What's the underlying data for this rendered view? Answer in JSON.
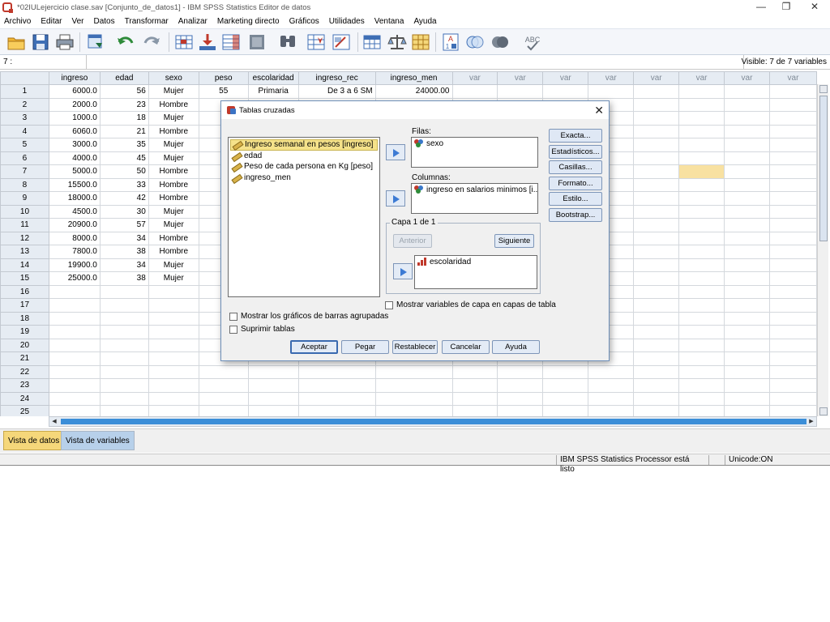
{
  "window": {
    "title": "*02IULejercicio clase.sav [Conjunto_de_datos1] - IBM SPSS Statistics Editor de datos"
  },
  "menu": [
    "Archivo",
    "Editar",
    "Ver",
    "Datos",
    "Transformar",
    "Analizar",
    "Marketing directo",
    "Gráficos",
    "Utilidades",
    "Ventana",
    "Ayuda"
  ],
  "toolbar_icons": [
    "open-icon",
    "save-icon",
    "print-icon",
    "dialog-recall-icon",
    "undo-icon",
    "redo-icon",
    "goto-case-icon",
    "goto-variable-icon",
    "variables-icon",
    "run-descriptives-icon",
    "find-icon",
    "insert-cases-icon",
    "insert-variable-icon",
    "split-file-icon",
    "weight-cases-icon",
    "select-cases-icon",
    "value-labels-icon",
    "use-sets-icon",
    "show-all-icon",
    "spell-check-icon"
  ],
  "cellbar": {
    "ref": "7 :",
    "value": "",
    "visible": "Visible: 7 de 7 variables"
  },
  "grid": {
    "columns": [
      "ingreso",
      "edad",
      "sexo",
      "peso",
      "escolaridad",
      "ingreso_rec",
      "ingreso_men",
      "var",
      "var",
      "var",
      "var",
      "var",
      "var",
      "var",
      "var"
    ],
    "rows": [
      [
        "1",
        "6000.0",
        "56",
        "Mujer",
        "55",
        "Primaria",
        "De 3 a 6 SM",
        "24000.00"
      ],
      [
        "2",
        "2000.0",
        "23",
        "Hombre",
        "",
        "",
        "",
        ""
      ],
      [
        "3",
        "1000.0",
        "18",
        "Mujer",
        "",
        "",
        "",
        ""
      ],
      [
        "4",
        "6060.0",
        "21",
        "Hombre",
        "",
        "",
        "",
        ""
      ],
      [
        "5",
        "3000.0",
        "35",
        "Mujer",
        "",
        "",
        "",
        ""
      ],
      [
        "6",
        "4000.0",
        "45",
        "Mujer",
        "",
        "",
        "",
        ""
      ],
      [
        "7",
        "5000.0",
        "50",
        "Hombre",
        "",
        "",
        "",
        ""
      ],
      [
        "8",
        "15500.0",
        "33",
        "Hombre",
        "",
        "",
        "",
        ""
      ],
      [
        "9",
        "18000.0",
        "42",
        "Hombre",
        "",
        "",
        "",
        ""
      ],
      [
        "10",
        "4500.0",
        "30",
        "Mujer",
        "",
        "",
        "",
        ""
      ],
      [
        "11",
        "20900.0",
        "57",
        "Mujer",
        "",
        "",
        "",
        ""
      ],
      [
        "12",
        "8000.0",
        "34",
        "Hombre",
        "",
        "",
        "",
        ""
      ],
      [
        "13",
        "7800.0",
        "38",
        "Hombre",
        "",
        "",
        "",
        ""
      ],
      [
        "14",
        "19900.0",
        "34",
        "Mujer",
        "",
        "",
        "",
        ""
      ],
      [
        "15",
        "25000.0",
        "38",
        "Mujer",
        "",
        "",
        "",
        ""
      ],
      [
        "16",
        "",
        "",
        "",
        "",
        "",
        "",
        ""
      ],
      [
        "17",
        "",
        "",
        "",
        "",
        "",
        "",
        ""
      ],
      [
        "18",
        "",
        "",
        "",
        "",
        "",
        "",
        ""
      ],
      [
        "19",
        "",
        "",
        "",
        "",
        "",
        "",
        ""
      ],
      [
        "20",
        "",
        "",
        "",
        "",
        "",
        "",
        ""
      ],
      [
        "21",
        "",
        "",
        "",
        "",
        "",
        "",
        ""
      ],
      [
        "22",
        "",
        "",
        "",
        "",
        "",
        "",
        ""
      ],
      [
        "23",
        "",
        "",
        "",
        "",
        "",
        "",
        ""
      ],
      [
        "24",
        "",
        "",
        "",
        "",
        "",
        "",
        ""
      ],
      [
        "25",
        "",
        "",
        "",
        "",
        "",
        "",
        ""
      ]
    ],
    "highlight_color": "#f8e1a1"
  },
  "tabs": {
    "data_view": "Vista de datos",
    "variable_view": "Vista de variables"
  },
  "status": {
    "processor": "IBM SPSS Statistics Processor está listo",
    "unicode": "Unicode:ON"
  },
  "dialog": {
    "title": "Tablas cruzadas",
    "source_vars": [
      {
        "label": "Ingreso semanal en pesos [ingreso]",
        "selected": true
      },
      {
        "label": "edad",
        "selected": false
      },
      {
        "label": "Peso de cada persona en Kg [peso]",
        "selected": false
      },
      {
        "label": "ingreso_men",
        "selected": false
      }
    ],
    "rows_label": "Filas:",
    "rows_var": "sexo",
    "columns_label": "Columnas:",
    "columns_var": "ingreso en salarios minimos [i...",
    "layer_label": "Capa 1 de 1",
    "prev_button": "Anterior",
    "next_button": "Siguiente",
    "layer_var": "escolaridad",
    "show_layer_check": "Mostrar variables de capa en capas de tabla",
    "clustered_bar_check": "Mostrar los gráficos de barras agrupadas",
    "suppress_check": "Suprimir tablas",
    "side_buttons": [
      "Exacta...",
      "Estadísticos...",
      "Casillas...",
      "Formato...",
      "Estilo...",
      "Bootstrap..."
    ],
    "bottom_buttons": [
      "Aceptar",
      "Pegar",
      "Restablecer",
      "Cancelar",
      "Ayuda"
    ],
    "accent": "#3d7bd4"
  }
}
